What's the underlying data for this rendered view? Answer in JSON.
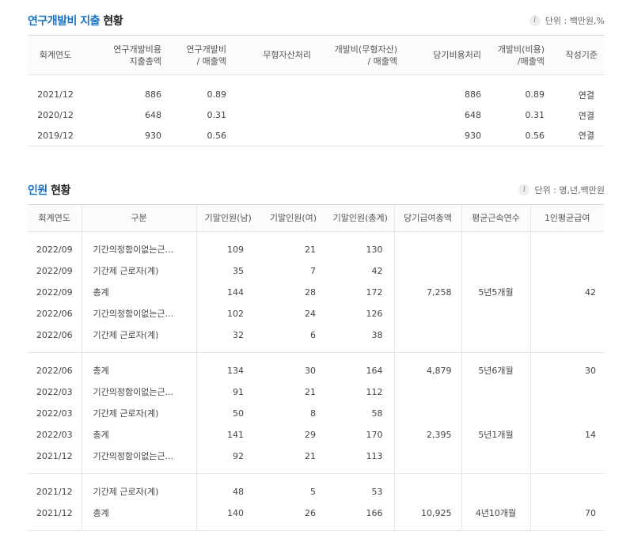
{
  "rnd": {
    "title_highlight": "연구개발비 지출",
    "title_rest": " 현황",
    "unit": "단위 : 백만원,%",
    "headers": [
      "회계연도",
      "연구개발비용\n지출총액",
      "연구개발비\n/ 매출액",
      "무형자산처리",
      "개발비(무형자산)\n/ 매출액",
      "당기비용처리",
      "개발비(비용)\n/매출액",
      "작성기준"
    ],
    "rows": [
      [
        "2021/12",
        "886",
        "0.89",
        "",
        "",
        "886",
        "0.89",
        "연결"
      ],
      [
        "2020/12",
        "648",
        "0.31",
        "",
        "",
        "648",
        "0.31",
        "연결"
      ],
      [
        "2019/12",
        "930",
        "0.56",
        "",
        "",
        "930",
        "0.56",
        "연결"
      ]
    ]
  },
  "staff": {
    "title_highlight": "인원",
    "title_rest": " 현황",
    "unit": "단위 : 명,년,백만원",
    "headers": [
      "회계연도",
      "구분",
      "기말인원(남)",
      "기말인원(여)",
      "기말인원(총계)",
      "당기급여총액",
      "평균근속연수",
      "1인평균급여"
    ],
    "groups": [
      {
        "rows": [
          [
            "2022/09",
            "기간의정함이없는근...",
            "109",
            "21",
            "130"
          ],
          [
            "2022/09",
            "기간제 근로자(계)",
            "35",
            "7",
            "42"
          ],
          [
            "2022/09",
            "총계",
            "144",
            "28",
            "172"
          ],
          [
            "2022/06",
            "기간의정함이없는근...",
            "102",
            "24",
            "126"
          ],
          [
            "2022/06",
            "기간제 근로자(계)",
            "32",
            "6",
            "38"
          ]
        ],
        "pay": "7,258",
        "tenure": "5년5개월",
        "avg": "42"
      },
      {
        "rows": [
          [
            "2022/06",
            "총계",
            "134",
            "30",
            "164"
          ],
          [
            "2022/03",
            "기간의정함이없는근...",
            "91",
            "21",
            "112"
          ],
          [
            "2022/03",
            "기간제 근로자(계)",
            "50",
            "8",
            "58"
          ],
          [
            "2022/03",
            "총계",
            "141",
            "29",
            "170"
          ],
          [
            "2021/12",
            "기간의정함이없는근...",
            "92",
            "21",
            "113"
          ]
        ],
        "extra": [
          {
            "row": 0,
            "pay": "4,879",
            "tenure": "5년6개월",
            "avg": "30"
          },
          {
            "row": 3,
            "pay": "2,395",
            "tenure": "5년1개월",
            "avg": "14"
          }
        ]
      },
      {
        "rows": [
          [
            "2021/12",
            "기간제 근로자(계)",
            "48",
            "5",
            "53"
          ],
          [
            "2021/12",
            "총계",
            "140",
            "26",
            "166"
          ]
        ],
        "extra": [
          {
            "row": 1,
            "pay": "10,925",
            "tenure": "4년10개월",
            "avg": "70"
          }
        ]
      }
    ]
  }
}
